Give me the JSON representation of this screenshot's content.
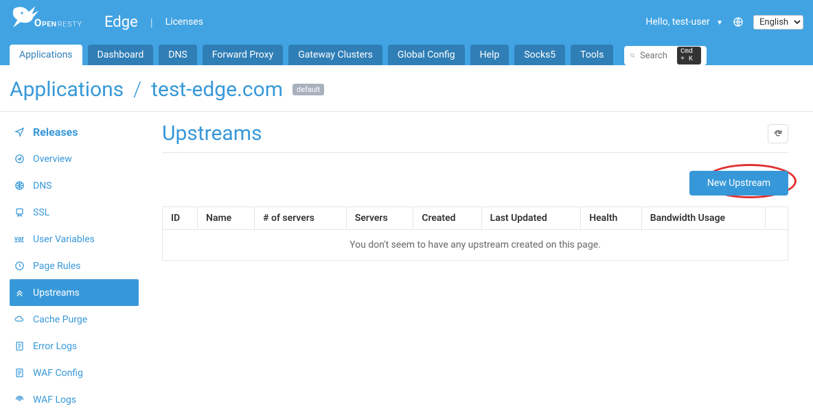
{
  "header": {
    "brand_sub": "Edge",
    "licenses": "Licenses",
    "hello": "Hello, test-user",
    "lang": "English"
  },
  "nav": {
    "tabs": [
      {
        "label": "Applications",
        "active": true
      },
      {
        "label": "Dashboard"
      },
      {
        "label": "DNS"
      },
      {
        "label": "Forward Proxy"
      },
      {
        "label": "Gateway Clusters"
      },
      {
        "label": "Global Config"
      },
      {
        "label": "Help"
      },
      {
        "label": "Socks5"
      },
      {
        "label": "Tools"
      }
    ],
    "search_placeholder": "Search",
    "search_kbd": "Cmd + K"
  },
  "breadcrumb": {
    "root": "Applications",
    "sep": "/",
    "current": "test-edge.com",
    "badge": "default"
  },
  "sidebar": {
    "items": [
      {
        "label": "Releases",
        "icon": "paper-plane",
        "releases": true
      },
      {
        "label": "Overview",
        "icon": "compass"
      },
      {
        "label": "DNS",
        "icon": "globe-grid"
      },
      {
        "label": "SSL",
        "icon": "cert"
      },
      {
        "label": "User Variables",
        "icon": "var"
      },
      {
        "label": "Page Rules",
        "icon": "clock"
      },
      {
        "label": "Upstreams",
        "icon": "double-chevron-up",
        "active": true
      },
      {
        "label": "Cache Purge",
        "icon": "cloud"
      },
      {
        "label": "Error Logs",
        "icon": "file-list"
      },
      {
        "label": "WAF Config",
        "icon": "shield-list"
      },
      {
        "label": "WAF Logs",
        "icon": "ripple"
      }
    ]
  },
  "page": {
    "title": "Upstreams",
    "new_button": "New Upstream",
    "columns": [
      "ID",
      "Name",
      "# of servers",
      "Servers",
      "Created",
      "Last Updated",
      "Health",
      "Bandwidth Usage",
      ""
    ],
    "empty_message": "You don't seem to have any upstream created on this page."
  }
}
